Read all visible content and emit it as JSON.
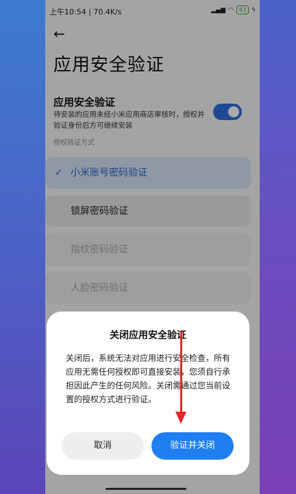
{
  "statusbar": {
    "time_speed": "上午10:54 | 70.4K/s",
    "battery": "83"
  },
  "page": {
    "title": "应用安全验证"
  },
  "setting": {
    "title": "应用安全验证",
    "description": "待安装的应用未经小米应用商店审核时，授权并验证身份后方可继续安装",
    "enabled": true,
    "subheading": "授权验证方式"
  },
  "options": [
    {
      "label": "小米账号密码验证",
      "selected": true,
      "enabled": true
    },
    {
      "label": "锁屏密码验证",
      "selected": false,
      "enabled": true
    },
    {
      "label": "指纹密码验证",
      "selected": false,
      "enabled": false
    },
    {
      "label": "人脸密码验证",
      "selected": false,
      "enabled": false
    }
  ],
  "dialog": {
    "title": "关闭应用安全验证",
    "body": "关闭后，系统无法对应用进行安全检查，所有应用无需任何授权即可直接安装，您须自行承担因此产生的任何风险。关闭需通过您当前设置的授权方式进行验证。",
    "cancel_label": "取消",
    "confirm_label": "验证并关闭"
  },
  "colors": {
    "accent": "#1f7ff0",
    "toggle_on": "#2f6fdc",
    "annotation_arrow": "#e8262a"
  }
}
